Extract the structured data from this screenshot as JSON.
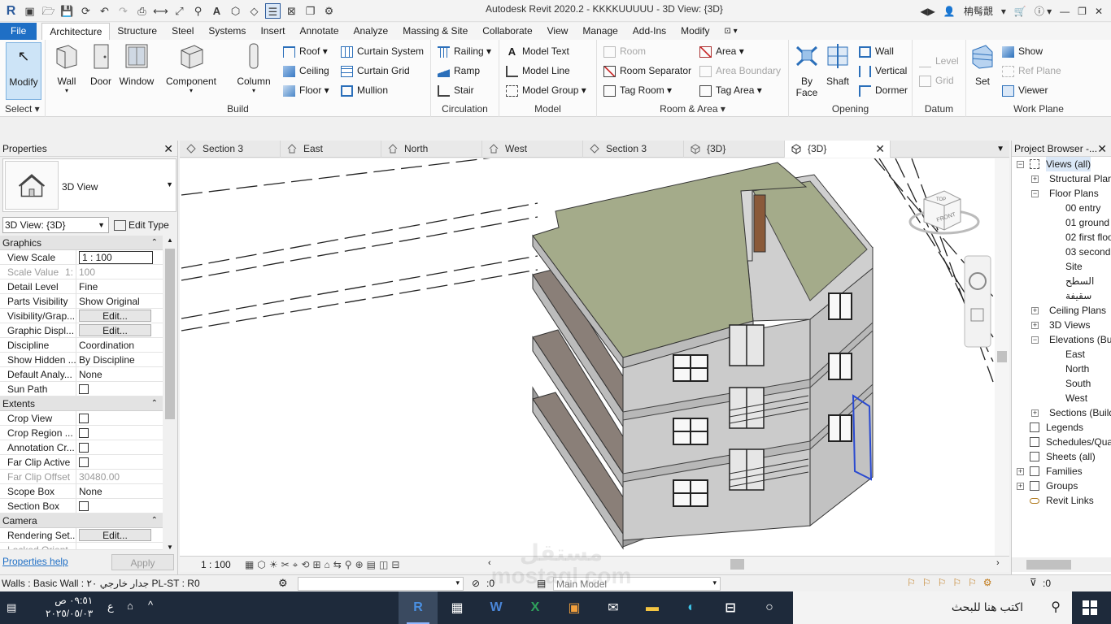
{
  "titlebar": {
    "title": "Autodesk Revit 2020.2 - KKKKUUUUU - 3D View: {3D}",
    "user": "柟髩覿"
  },
  "menu": {
    "file": "File",
    "tabs": [
      "Architecture",
      "Structure",
      "Steel",
      "Systems",
      "Insert",
      "Annotate",
      "Analyze",
      "Massing & Site",
      "Collaborate",
      "View",
      "Manage",
      "Add-Ins",
      "Modify"
    ]
  },
  "ribbon": {
    "select": {
      "modify": "Modify",
      "panel": "Select ▾"
    },
    "build": {
      "wall": "Wall",
      "door": "Door",
      "window": "Window",
      "component": "Component",
      "column": "Column",
      "roof": "Roof",
      "ceiling": "Ceiling",
      "floor": "Floor",
      "curtain_system": "Curtain System",
      "curtain_grid": "Curtain Grid",
      "mullion": "Mullion",
      "panel": "Build"
    },
    "circulation": {
      "railing": "Railing",
      "ramp": "Ramp",
      "stair": "Stair",
      "panel": "Circulation"
    },
    "model": {
      "model_text": "Model Text",
      "model_line": "Model Line",
      "model_group": "Model Group",
      "panel": "Model"
    },
    "room_area": {
      "room": "Room",
      "room_separator": "Room Separator",
      "tag_room": "Tag Room",
      "area": "Area",
      "area_boundary": "Area Boundary",
      "tag_area": "Tag Area",
      "panel": "Room & Area ▾"
    },
    "opening": {
      "by_face": "By Face",
      "shaft": "Shaft",
      "wall": "Wall",
      "vertical": "Vertical",
      "dormer": "Dormer",
      "panel": "Opening"
    },
    "datum": {
      "level": "Level",
      "grid": "Grid",
      "panel": "Datum"
    },
    "work_plane": {
      "set": "Set",
      "show": "Show",
      "ref_plane": "Ref Plane",
      "viewer": "Viewer",
      "panel": "Work Plane"
    }
  },
  "properties": {
    "title": "Properties",
    "type_name": "3D View",
    "view_selector": "3D View: {3D}",
    "edit_type": "Edit Type",
    "cat_graphics": "Graphics",
    "cat_extents": "Extents",
    "cat_camera": "Camera",
    "rows": {
      "view_scale": {
        "k": "View Scale",
        "v": "1 : 100"
      },
      "scale_value": {
        "k": "Scale Value",
        "v1": "1:",
        "v": "100"
      },
      "detail_level": {
        "k": "Detail Level",
        "v": "Fine"
      },
      "parts_visibility": {
        "k": "Parts Visibility",
        "v": "Show Original"
      },
      "visibility_graphics": {
        "k": "Visibility/Grap...",
        "v": "Edit..."
      },
      "graphic_display": {
        "k": "Graphic Displ...",
        "v": "Edit..."
      },
      "discipline": {
        "k": "Discipline",
        "v": "Coordination"
      },
      "show_hidden": {
        "k": "Show Hidden ...",
        "v": "By Discipline"
      },
      "default_analysis": {
        "k": "Default Analy...",
        "v": "None"
      },
      "sun_path": {
        "k": "Sun Path"
      },
      "crop_view": {
        "k": "Crop View"
      },
      "crop_region": {
        "k": "Crop Region ..."
      },
      "annotation_crop": {
        "k": "Annotation Cr..."
      },
      "far_clip_active": {
        "k": "Far Clip Active"
      },
      "far_clip_offset": {
        "k": "Far Clip Offset",
        "v": "30480.00"
      },
      "scope_box": {
        "k": "Scope Box",
        "v": "None"
      },
      "section_box": {
        "k": "Section Box"
      },
      "rendering_settings": {
        "k": "Rendering Set...",
        "v": "Edit..."
      },
      "locked_orient": {
        "k": "Locked Orient..."
      }
    },
    "help": "Properties help",
    "apply": "Apply"
  },
  "view_tabs": [
    {
      "label": "Section 3",
      "icon": "section-icon"
    },
    {
      "label": "East",
      "icon": "elevation-icon"
    },
    {
      "label": "North",
      "icon": "elevation-icon"
    },
    {
      "label": "West",
      "icon": "elevation-icon"
    },
    {
      "label": "Section 3",
      "icon": "section-icon"
    },
    {
      "label": "{3D}",
      "icon": "3d-icon"
    },
    {
      "label": "{3D}",
      "icon": "3d-icon",
      "active": true
    }
  ],
  "viewcube": {
    "top": "TOP",
    "front": "FRONT"
  },
  "view_control": {
    "scale": "1 : 100"
  },
  "browser": {
    "title": "Project Browser -...",
    "nodes": {
      "views_all": "Views (all)",
      "structural_plans": "Structural Plans",
      "floor_plans": "Floor Plans",
      "fp1": "00 entry",
      "fp2": "01 ground floor",
      "fp3": "02 first floor",
      "fp4": "03 second",
      "fp5": "Site",
      "fp6": "السطح",
      "fp7": "سقيفة",
      "ceiling_plans": "Ceiling Plans",
      "views_3d": "3D Views",
      "elevations": "Elevations (Building Elevation)",
      "e1": "East",
      "e2": "North",
      "e3": "South",
      "e4": "West",
      "sections": "Sections (Building Section)",
      "legends": "Legends",
      "schedules": "Schedules/Quantities",
      "sheets": "Sheets (all)",
      "families": "Families",
      "groups": "Groups",
      "revit_links": "Revit Links"
    }
  },
  "status": {
    "message": "Walls : Basic Wall : جدار خارجي ٢٠ PL-ST : R0",
    "zero1": ":0",
    "main_model": "Main Model",
    "zero2": ":0"
  },
  "taskbar": {
    "time": "٠٩:٥١ ص",
    "date": "٢٠٢٥/٠٥/٠٣",
    "lang": "ع",
    "search_placeholder": "اكتب هنا للبحث"
  },
  "watermark": "مستقل mostaql.com",
  "colors": {
    "accent": "#1f6fc5",
    "roof": "#9aa882",
    "walls": "#c9c9c9",
    "taskbar": "#1e2a3b"
  }
}
